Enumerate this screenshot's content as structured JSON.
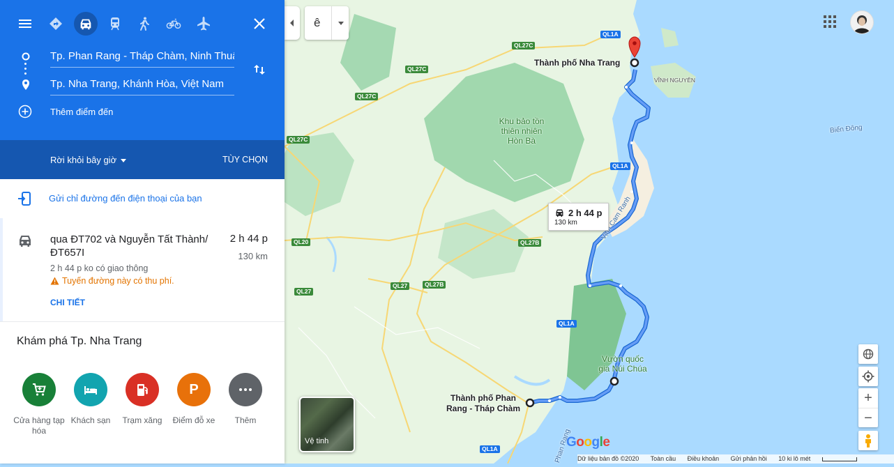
{
  "travel_modes": [
    {
      "name": "best-route",
      "icon": "diamond-directions-icon"
    },
    {
      "name": "driving",
      "icon": "car-icon",
      "selected": true
    },
    {
      "name": "transit",
      "icon": "train-icon"
    },
    {
      "name": "walking",
      "icon": "walking-icon"
    },
    {
      "name": "cycling",
      "icon": "bicycle-icon"
    },
    {
      "name": "flight",
      "icon": "airplane-icon"
    }
  ],
  "waypoints": {
    "origin": "Tp. Phan Rang - Tháp Chàm, Ninh Thuận",
    "destination": "Tp. Nha Trang, Khánh Hòa, Việt Nam",
    "add_destination": "Thêm điểm đến"
  },
  "depart": {
    "label": "Rời khỏi bây giờ",
    "options": "TÙY CHỌN"
  },
  "send_to_phone": "Gửi chỉ đường đến điện thoại của bạn",
  "route": {
    "via": "qua ĐT702 và Nguyễn Tất Thành/ ĐT657I",
    "time": "2 h 44 p",
    "distance": "130 km",
    "traffic_note": "2 h 44 p ko có giao thông",
    "warning": "Tuyến đường này có thu phí.",
    "details": "CHI TIẾT"
  },
  "explore": {
    "title": "Khám phá Tp. Nha Trang",
    "categories": [
      {
        "label": "Cửa hàng tạp hóa",
        "color": "#188038",
        "icon": "cart-icon"
      },
      {
        "label": "Khách sạn",
        "color": "#12a4af",
        "icon": "bed-icon"
      },
      {
        "label": "Trạm xăng",
        "color": "#d93025",
        "icon": "fuel-icon"
      },
      {
        "label": "Điểm đỗ xe",
        "color": "#e8710a",
        "icon": "parking-icon"
      },
      {
        "label": "Thêm",
        "color": "#5f6368",
        "icon": "more-icon"
      }
    ]
  },
  "map": {
    "language_toggle": "ê",
    "route_bubble": {
      "time": "2 h 44 p",
      "distance": "130 km"
    },
    "labels": {
      "nha_trang": "Thành phố Nha Trang",
      "phan_rang_1": "Thành phố Phan",
      "phan_rang_2": "Rang - Tháp Chàm",
      "vinh_nguyen": "VĨNH NGUYÊN",
      "bien_dong": "Biển Đông",
      "hon_ba_1": "Khu bảo tồn",
      "hon_ba_2": "thiên nhiên",
      "hon_ba_3": "Hòn Bà",
      "nui_chua_1": "Vườn quốc",
      "nui_chua_2": "gia Núi Chúa",
      "vinh_cam_ranh": "Vịnh Cam Ranh",
      "phan_rang_bay": "Phan Rang"
    },
    "roads": [
      "QL1A",
      "QL27C",
      "QL27C",
      "QL27C",
      "QL27C",
      "QL1A",
      "QL20",
      "QL27B",
      "QL27",
      "QL27B",
      "QL27",
      "QL1A",
      "QL1A"
    ],
    "satellite_label": "Vệ tinh",
    "footer": [
      "Dữ liệu bản đồ ©2020",
      "Toàn cầu",
      "Điều khoản",
      "Gửi phản hồi",
      "10 ki lô mét"
    ],
    "logo": "Google",
    "colors": {
      "route": "#4285f4",
      "land": "#e8f5e3",
      "forest": "#94d2a5",
      "water": "#aadaff",
      "pin": "#ea4335"
    }
  }
}
